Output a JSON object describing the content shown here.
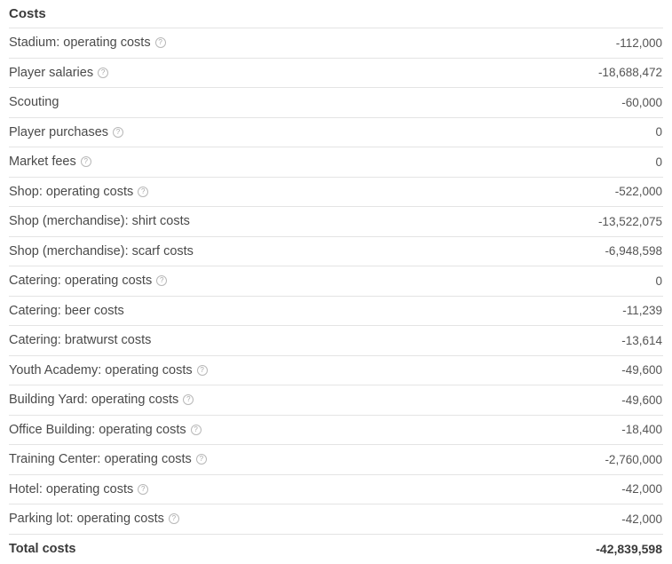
{
  "title": "Costs",
  "rows": [
    {
      "label": "Stadium: operating costs",
      "help": true,
      "value": "-112,000"
    },
    {
      "label": "Player salaries",
      "help": true,
      "value": "-18,688,472"
    },
    {
      "label": "Scouting",
      "help": false,
      "value": "-60,000"
    },
    {
      "label": "Player purchases",
      "help": true,
      "value": "0"
    },
    {
      "label": "Market fees",
      "help": true,
      "value": "0"
    },
    {
      "label": "Shop: operating costs",
      "help": true,
      "value": "-522,000"
    },
    {
      "label": "Shop (merchandise): shirt costs",
      "help": false,
      "value": "-13,522,075"
    },
    {
      "label": "Shop (merchandise): scarf costs",
      "help": false,
      "value": "-6,948,598"
    },
    {
      "label": "Catering: operating costs",
      "help": true,
      "value": "0"
    },
    {
      "label": "Catering: beer costs",
      "help": false,
      "value": "-11,239"
    },
    {
      "label": "Catering: bratwurst costs",
      "help": false,
      "value": "-13,614"
    },
    {
      "label": "Youth Academy: operating costs",
      "help": true,
      "value": "-49,600"
    },
    {
      "label": "Building Yard: operating costs",
      "help": true,
      "value": "-49,600"
    },
    {
      "label": "Office Building: operating costs",
      "help": true,
      "value": "-18,400"
    },
    {
      "label": "Training Center: operating costs",
      "help": true,
      "value": "-2,760,000"
    },
    {
      "label": "Hotel: operating costs",
      "help": true,
      "value": "-42,000"
    },
    {
      "label": "Parking lot: operating costs",
      "help": true,
      "value": "-42,000"
    }
  ],
  "total": {
    "label": "Total costs",
    "value": "-42,839,598"
  },
  "help_glyph": "?",
  "icons": {
    "help": "question-circle-icon"
  }
}
